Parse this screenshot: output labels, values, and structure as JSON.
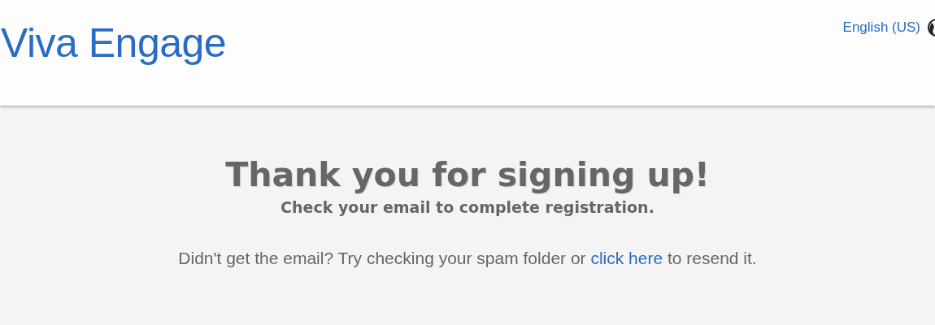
{
  "header": {
    "logo": "Viva Engage",
    "language": "English (US)"
  },
  "main": {
    "title": "Thank you for signing up!",
    "subtitle": "Check your email to complete registration.",
    "note": {
      "before": "Didn't get the email? Try checking your spam folder or",
      "link": "click here",
      "after": "to resend it."
    }
  }
}
